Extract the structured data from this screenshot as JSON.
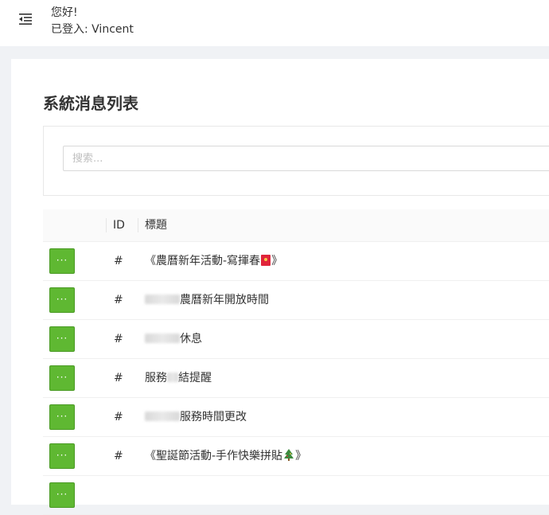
{
  "header": {
    "greeting": "您好!",
    "logged_in": "已登入: Vincent"
  },
  "page": {
    "title": "系統消息列表"
  },
  "search": {
    "placeholder": "搜索..."
  },
  "table": {
    "columns": [
      "",
      "ID",
      "標題"
    ],
    "action_label": "···",
    "rows": [
      {
        "id": "#",
        "title_prefix": "《農曆新年活動-寫揮春",
        "title_suffix": "》",
        "emoji": "red-envelope"
      },
      {
        "id": "#",
        "title_prefix": "",
        "title_suffix": "農曆新年開放時間",
        "blurred": "redacted"
      },
      {
        "id": "#",
        "title_prefix": "",
        "title_suffix": "休息",
        "blurred": "redacted"
      },
      {
        "id": "#",
        "title_prefix": "服務",
        "title_suffix": "結提醒",
        "blurred": "redacted"
      },
      {
        "id": "#",
        "title_prefix": "",
        "title_suffix": "服務時間更改",
        "blurred": "redacted"
      },
      {
        "id": "#",
        "title_prefix": "《聖誕節活動-手作快樂拼貼",
        "title_suffix": "》",
        "emoji": "christmas-tree"
      }
    ]
  },
  "colors": {
    "action_button": "#5fb832",
    "background": "#f0f2f5"
  }
}
